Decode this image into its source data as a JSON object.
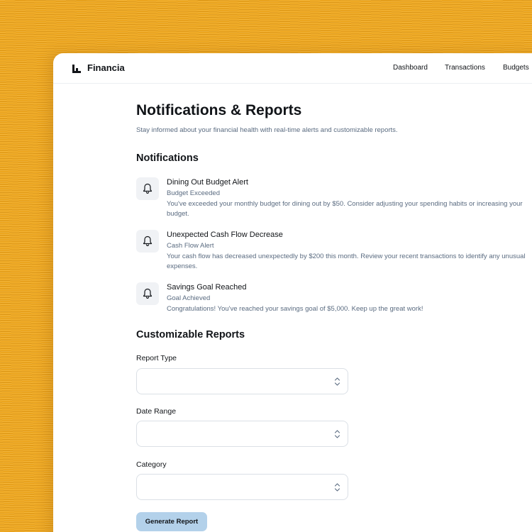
{
  "app": {
    "brand": "Financia"
  },
  "nav": [
    {
      "label": "Dashboard"
    },
    {
      "label": "Transactions"
    },
    {
      "label": "Budgets"
    }
  ],
  "page": {
    "title": "Notifications & Reports",
    "subtitle": "Stay informed about your financial health with real-time alerts and customizable reports."
  },
  "notifications": {
    "heading": "Notifications",
    "items": [
      {
        "title": "Dining Out Budget Alert",
        "type": "Budget Exceeded",
        "message": "You've exceeded your monthly budget for dining out by $50. Consider adjusting your spending habits or increasing your budget.",
        "icon": "bell-icon"
      },
      {
        "title": "Unexpected Cash Flow Decrease",
        "type": "Cash Flow Alert",
        "message": "Your cash flow has decreased unexpectedly by $200 this month. Review your recent transactions to identify any unusual expenses.",
        "icon": "bell-icon"
      },
      {
        "title": "Savings Goal Reached",
        "type": "Goal Achieved",
        "message": "Congratulations! You've reached your savings goal of $5,000. Keep up the great work!",
        "icon": "bell-icon"
      }
    ]
  },
  "reports": {
    "heading": "Customizable Reports",
    "fields": [
      {
        "label": "Report Type",
        "value": ""
      },
      {
        "label": "Date Range",
        "value": ""
      },
      {
        "label": "Category",
        "value": ""
      }
    ],
    "generate_label": "Generate Report"
  },
  "colors": {
    "background": "#eca51e",
    "primary_button": "#b3d1ea",
    "muted_text": "#5a6b80",
    "text": "#111418"
  }
}
